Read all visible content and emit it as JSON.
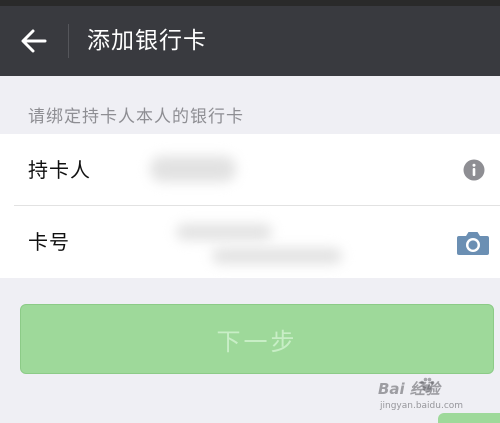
{
  "header": {
    "title": "添加银行卡",
    "back_icon": "arrow-left-icon"
  },
  "hint": "请绑定持卡人本人的银行卡",
  "form": {
    "rows": [
      {
        "label": "持卡人",
        "value": "",
        "placeholder": "",
        "icon": "info-icon"
      },
      {
        "label": "卡号",
        "value": "",
        "placeholder": "",
        "icon": "camera-icon"
      }
    ]
  },
  "next_button": {
    "label": "下一步",
    "enabled": false
  },
  "watermark": {
    "text": "Bai 经验",
    "sub": "jingyan.baidu.com"
  },
  "colors": {
    "header_bg": "#393a3f",
    "page_bg": "#efeff4",
    "button_bg_disabled": "#9ed99a",
    "button_text_disabled": "#c8eec6",
    "icon_gray": "#8e8e93",
    "camera_blue": "#6b8fb3"
  }
}
